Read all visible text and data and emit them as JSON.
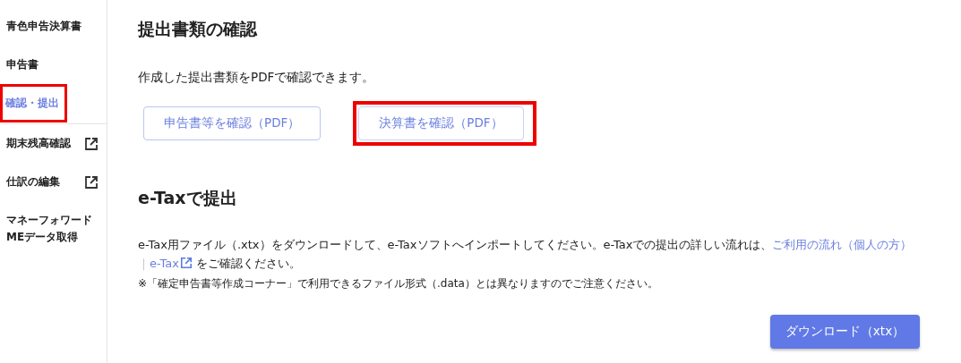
{
  "sidebar": {
    "items": [
      {
        "label": "青色申告決算書",
        "selected": false,
        "highlighted": false,
        "external": false
      },
      {
        "label": "申告書",
        "selected": false,
        "highlighted": false,
        "external": false
      },
      {
        "label": "確認・提出",
        "selected": true,
        "highlighted": true,
        "external": false
      },
      {
        "label": "期末残高確認",
        "selected": false,
        "highlighted": false,
        "external": true
      },
      {
        "label": "仕訳の編集",
        "selected": false,
        "highlighted": false,
        "external": true
      },
      {
        "label": "マネーフォワード MEデータ取得",
        "selected": false,
        "highlighted": false,
        "external": false
      }
    ]
  },
  "confirm": {
    "title": "提出書類の確認",
    "description": "作成した提出書類をPDFで確認できます。",
    "buttons": [
      {
        "label": "申告書等を確認（PDF）",
        "highlighted": false
      },
      {
        "label": "決算書を確認（PDF）",
        "highlighted": true
      }
    ]
  },
  "etax": {
    "title": "e-Taxで提出",
    "paragraph": [
      {
        "kind": "text",
        "text": "e-Tax用ファイル（.xtx）をダウンロードして、e-Taxソフトへインポートしてください。e-Taxでの提出の詳しい流れは、"
      },
      {
        "kind": "link",
        "text": "ご利用の流れ（個人の方）",
        "external": false
      },
      {
        "kind": "separator",
        "text": "｜"
      },
      {
        "kind": "link",
        "text": "e-Tax",
        "external": true
      },
      {
        "kind": "text",
        "text": " をご確認ください。"
      }
    ],
    "note": "※「確定申告書等作成コーナー」で利用できるファイル形式（.data）とは異なりますのでご注意ください。",
    "download_button": "ダウンロード（xtx）"
  }
}
